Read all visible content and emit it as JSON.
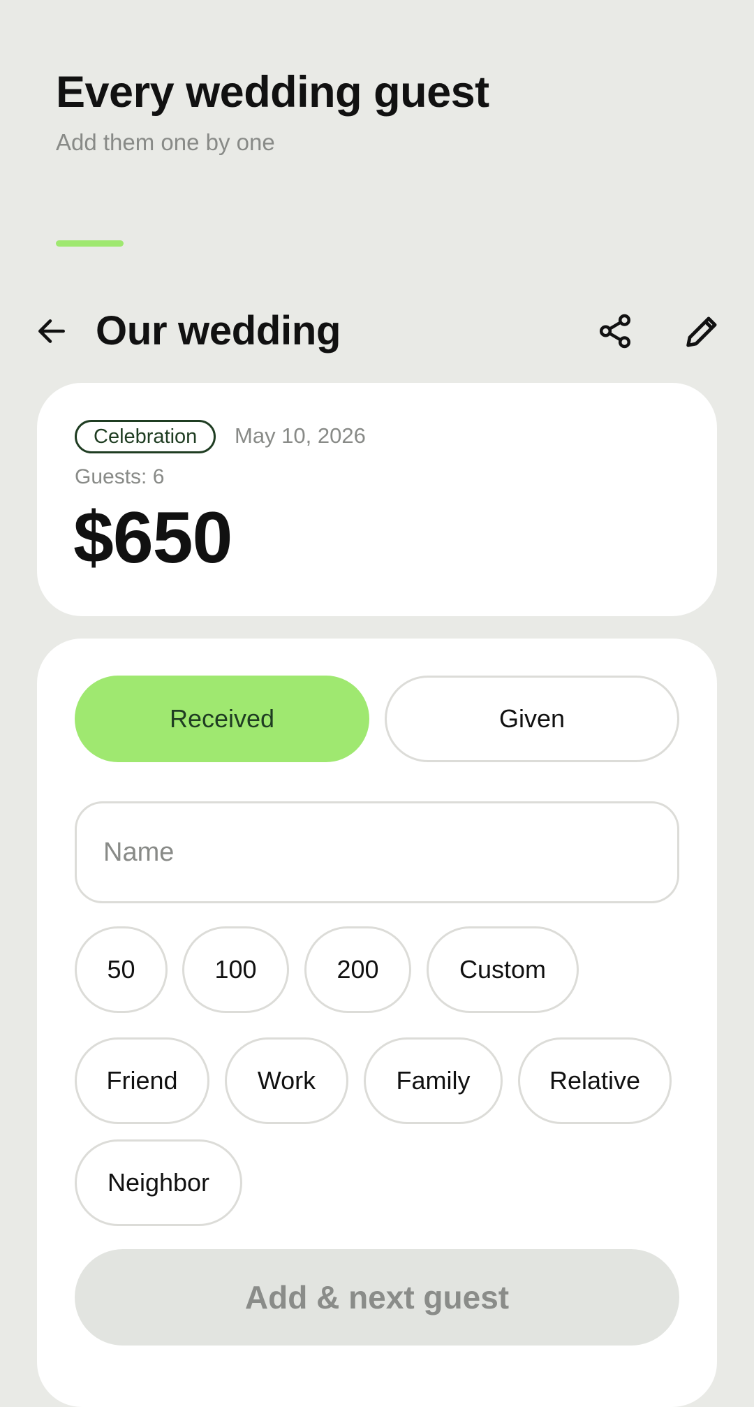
{
  "hero": {
    "title": "Every wedding guest",
    "subtitle": "Add them one by one"
  },
  "appbar": {
    "title": "Our wedding",
    "icons": [
      "back-arrow-icon",
      "share-icon",
      "pencil-icon"
    ]
  },
  "summary": {
    "badge": "Celebration",
    "date": "May 10, 2026",
    "guests": "Guests: 6",
    "total": "$650"
  },
  "form": {
    "segments": {
      "received": "Received",
      "given": "Given",
      "selected": "received"
    },
    "name_placeholder": "Name",
    "amounts": [
      "50",
      "100",
      "200",
      "Custom"
    ],
    "relations": [
      "Friend",
      "Work",
      "Family",
      "Relative",
      "Neighbor"
    ],
    "submit_label": "Add & next guest"
  },
  "colors": {
    "accent": "#9fe870",
    "accent_text": "#1f3d22",
    "background": "#e9eae6",
    "card": "#ffffff",
    "muted_text": "#888a87",
    "disabled_button": "#e2e4e0"
  }
}
